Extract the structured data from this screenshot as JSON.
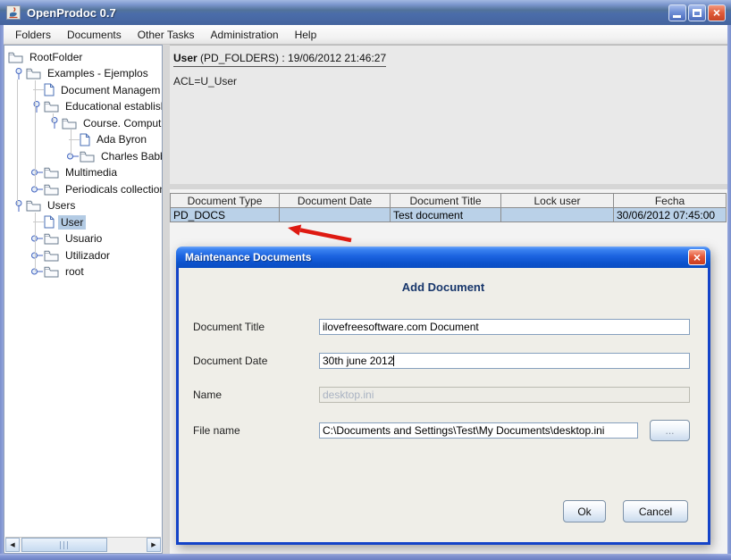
{
  "window": {
    "title": "OpenProdoc 0.7"
  },
  "menu": {
    "items": [
      "Folders",
      "Documents",
      "Other Tasks",
      "Administration",
      "Help"
    ]
  },
  "tree": {
    "items": [
      {
        "label": "RootFolder",
        "level": 0,
        "icon": "folder",
        "handle": null,
        "selected": false
      },
      {
        "label": "Examples - Ejemplos",
        "level": 1,
        "icon": "folder",
        "handle": "expanded",
        "selected": false
      },
      {
        "label": "Document Managem",
        "level": 2,
        "icon": "document",
        "handle": null,
        "selected": false
      },
      {
        "label": "Educational establish",
        "level": 2,
        "icon": "folder",
        "handle": "expanded",
        "selected": false
      },
      {
        "label": "Course. Computi",
        "level": 3,
        "icon": "folder",
        "handle": "expanded",
        "selected": false
      },
      {
        "label": "Ada Byron",
        "level": 4,
        "icon": "document",
        "handle": null,
        "selected": false
      },
      {
        "label": "Charles Babb",
        "level": 4,
        "icon": "folder",
        "handle": "collapsed",
        "selected": false
      },
      {
        "label": "Multimedia",
        "level": 2,
        "icon": "folder",
        "handle": "collapsed",
        "selected": false
      },
      {
        "label": "Periodicals collection",
        "level": 2,
        "icon": "folder",
        "handle": "collapsed",
        "selected": false
      },
      {
        "label": "Users",
        "level": 1,
        "icon": "folder",
        "handle": "expanded",
        "selected": false
      },
      {
        "label": "User",
        "level": 2,
        "icon": "document",
        "handle": null,
        "selected": true
      },
      {
        "label": "Usuario",
        "level": 2,
        "icon": "folder",
        "handle": "collapsed",
        "selected": false
      },
      {
        "label": "Utilizador",
        "level": 2,
        "icon": "folder",
        "handle": "collapsed",
        "selected": false
      },
      {
        "label": "root",
        "level": 2,
        "icon": "folder",
        "handle": "collapsed",
        "selected": false
      }
    ]
  },
  "info_panel": {
    "title_bold": "User",
    "title_rest": " (PD_FOLDERS) : 19/06/2012 21:46:27",
    "acl": "ACL=U_User"
  },
  "table": {
    "columns": [
      "Document Type",
      "Document Date",
      "Document Title",
      "Lock user",
      "Fecha"
    ],
    "rows": [
      {
        "selected": true,
        "cells": [
          "PD_DOCS",
          "",
          "Test document",
          "",
          "30/06/2012  07:45:00"
        ]
      }
    ]
  },
  "dialog": {
    "title": "Maintenance Documents",
    "heading": "Add Document",
    "fields": [
      {
        "label": "Document Title",
        "value": "ilovefreesoftware.com Document",
        "state": "enabled",
        "caret": false,
        "browse": null
      },
      {
        "label": "Document Date",
        "value": "30th june 2012",
        "state": "enabled",
        "caret": true,
        "browse": null
      },
      {
        "label": "Name",
        "value": "desktop.ini",
        "state": "disabled",
        "caret": false,
        "browse": null
      },
      {
        "label": "File name",
        "value": "C:\\Documents and Settings\\Test\\My Documents\\desktop.ini",
        "state": "enabled",
        "caret": false,
        "browse": "..."
      }
    ],
    "buttons": {
      "ok": "Ok",
      "cancel": "Cancel"
    }
  },
  "scrollbar": {
    "left_arrow": "◀",
    "right_arrow": "▶"
  },
  "colors": {
    "selection": "#B3CBE4",
    "dialog_border": "#1443C8",
    "arrow": "#DE1A12",
    "xp_blue": "#0C52CC"
  }
}
